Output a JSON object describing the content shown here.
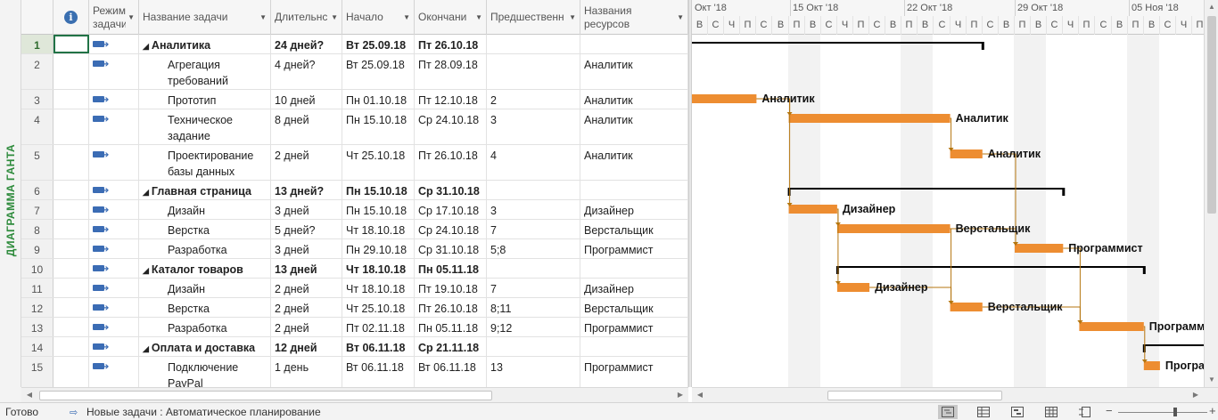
{
  "side_label": "ДИАГРАММА ГАНТА",
  "columns": {
    "indicator_icon": "info-icon",
    "mode": "Режим задачи",
    "name": "Название задачи",
    "duration": "Длительнс",
    "start": "Начало",
    "finish": "Окончани",
    "predecessors": "Предшественн",
    "resources": "Названия ресурсов"
  },
  "rows": [
    {
      "id": "1",
      "name": "Аналитика",
      "duration": "24 дней?",
      "start": "Вт 25.09.18",
      "finish": "Пт 26.10.18",
      "pred": "",
      "res": "",
      "summary": true
    },
    {
      "id": "2",
      "name": "Агрегация требований",
      "duration": "4 дней?",
      "start": "Вт 25.09.18",
      "finish": "Пт 28.09.18",
      "pred": "",
      "res": "Аналитик",
      "summary": false
    },
    {
      "id": "3",
      "name": "Прототип",
      "duration": "10 дней",
      "start": "Пн 01.10.18",
      "finish": "Пт 12.10.18",
      "pred": "2",
      "res": "Аналитик",
      "summary": false
    },
    {
      "id": "4",
      "name": "Техническое задание",
      "duration": "8 дней",
      "start": "Пн 15.10.18",
      "finish": "Ср 24.10.18",
      "pred": "3",
      "res": "Аналитик",
      "summary": false
    },
    {
      "id": "5",
      "name": "Проектирование базы данных",
      "duration": "2 дней",
      "start": "Чт 25.10.18",
      "finish": "Пт 26.10.18",
      "pred": "4",
      "res": "Аналитик",
      "summary": false
    },
    {
      "id": "6",
      "name": "Главная страница",
      "duration": "13 дней?",
      "start": "Пн 15.10.18",
      "finish": "Ср 31.10.18",
      "pred": "",
      "res": "",
      "summary": true
    },
    {
      "id": "7",
      "name": "Дизайн",
      "duration": "3 дней",
      "start": "Пн 15.10.18",
      "finish": "Ср 17.10.18",
      "pred": "3",
      "res": "Дизайнер",
      "summary": false
    },
    {
      "id": "8",
      "name": "Верстка",
      "duration": "5 дней?",
      "start": "Чт 18.10.18",
      "finish": "Ср 24.10.18",
      "pred": "7",
      "res": "Верстальщик",
      "summary": false
    },
    {
      "id": "9",
      "name": "Разработка",
      "duration": "3 дней",
      "start": "Пн 29.10.18",
      "finish": "Ср 31.10.18",
      "pred": "5;8",
      "res": "Программист",
      "summary": false
    },
    {
      "id": "10",
      "name": "Каталог товаров",
      "duration": "13 дней",
      "start": "Чт 18.10.18",
      "finish": "Пн 05.11.18",
      "pred": "",
      "res": "",
      "summary": true
    },
    {
      "id": "11",
      "name": "Дизайн",
      "duration": "2 дней",
      "start": "Чт 18.10.18",
      "finish": "Пт 19.10.18",
      "pred": "7",
      "res": "Дизайнер",
      "summary": false
    },
    {
      "id": "12",
      "name": "Верстка",
      "duration": "2 дней",
      "start": "Чт 25.10.18",
      "finish": "Пт 26.10.18",
      "pred": "8;11",
      "res": "Верстальщик",
      "summary": false
    },
    {
      "id": "13",
      "name": "Разработка",
      "duration": "2 дней",
      "start": "Пт 02.11.18",
      "finish": "Пн 05.11.18",
      "pred": "9;12",
      "res": "Программист",
      "summary": false
    },
    {
      "id": "14",
      "name": "Оплата и доставка",
      "duration": "12 дней",
      "start": "Вт 06.11.18",
      "finish": "Ср 21.11.18",
      "pred": "",
      "res": "",
      "summary": true
    },
    {
      "id": "15",
      "name": "Подключение PayPal",
      "duration": "1 день",
      "start": "Вт 06.11.18",
      "finish": "Вт 06.11.18",
      "pred": "13",
      "res": "Программист",
      "summary": false
    }
  ],
  "timescale": {
    "weeks": [
      "Окт '18",
      "15 Окт '18",
      "22 Окт '18",
      "29 Окт '18",
      "05 Ноя '18"
    ],
    "days": [
      "В",
      "С",
      "Ч",
      "П",
      "С",
      "В",
      "П",
      "В",
      "С",
      "Ч",
      "П",
      "С",
      "В",
      "П",
      "В",
      "С",
      "Ч",
      "П",
      "С",
      "В",
      "П",
      "В",
      "С",
      "Ч",
      "П",
      "С",
      "В",
      "П",
      "В",
      "С",
      "Ч",
      "П"
    ]
  },
  "bar_labels": [
    "Аналитик",
    "Аналитик",
    "Аналитик",
    "Дизайнер",
    "Верстальщик",
    "Программист",
    "Дизайнер",
    "Верстальщик",
    "Программи",
    "Програм"
  ],
  "colors": {
    "task_bar": "#ed8d31",
    "summary_bar": "#000000",
    "link": "#b5760f",
    "side_label": "#2e8b3c"
  },
  "status": {
    "ready": "Готово",
    "new_tasks": "Новые задачи : Автоматическое планирование"
  }
}
